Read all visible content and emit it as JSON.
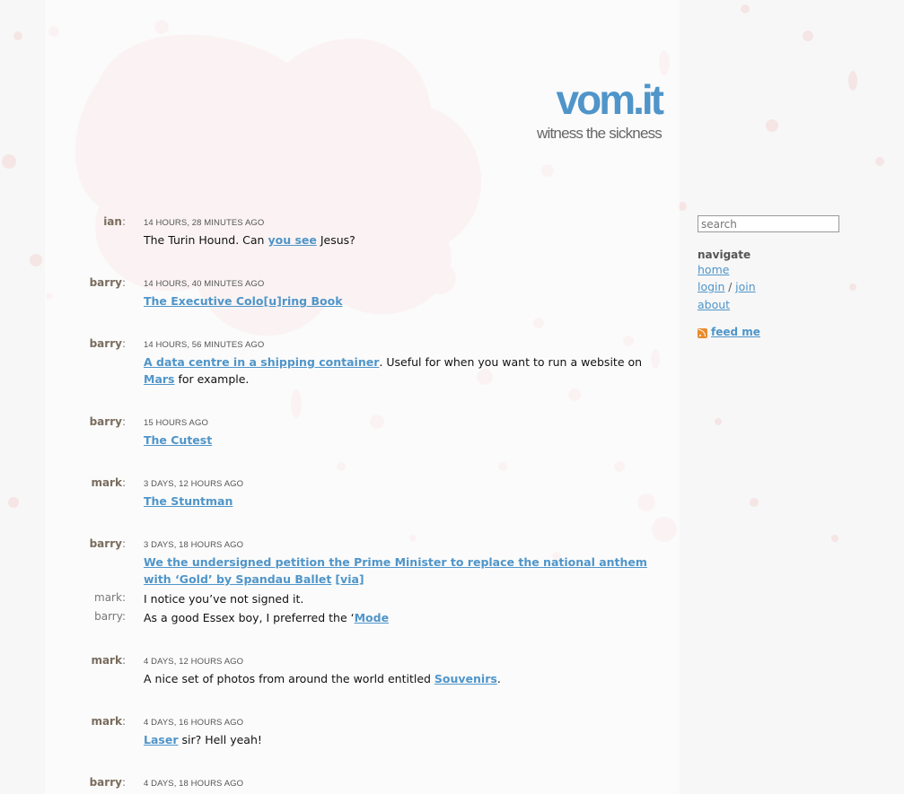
{
  "logo": {
    "brand": "vom.it",
    "tagline": "witness the sickness"
  },
  "entries": [
    {
      "user": "ian",
      "time": "14 hours, 28 minutes ago",
      "pre": "The Turin Hound. Can ",
      "link": "you see",
      "post": " Jesus?"
    },
    {
      "user": "barry",
      "time": "14 hours, 40 minutes ago",
      "pre": "",
      "link": "The Executive Colo[u]ring Book",
      "post": ""
    },
    {
      "user": "barry",
      "time": "14 hours, 56 minutes ago",
      "link": "A data centre in a shipping container",
      "mid": ". Useful for when you want to run a website on ",
      "link2": "Mars",
      "post": " for example."
    },
    {
      "user": "barry",
      "time": "15 hours ago",
      "pre": "",
      "link": "The Cutest",
      "post": ""
    },
    {
      "user": "mark",
      "time": "3 days, 12 hours ago",
      "pre": "",
      "link": "The Stuntman",
      "post": ""
    },
    {
      "user": "barry",
      "time": "3 days, 18 hours ago",
      "link": "We the undersigned petition the Prime Minister to replace the national anthem with ‘Gold’ by Spandau Ballet",
      "via": "[via]"
    },
    {
      "user": "mark",
      "time": "4 days, 12 hours ago",
      "pre": "A nice set of photos from around the world entitled ",
      "link": "Souvenirs",
      "post": "."
    },
    {
      "user": "mark",
      "time": "4 days, 16 hours ago",
      "pre": "",
      "link": "Laser",
      "post": " sir? Hell yeah!"
    },
    {
      "user": "barry",
      "time": "4 days, 18 hours ago"
    }
  ],
  "comments": [
    {
      "user": "mark",
      "text": "I notice you’ve not signed it."
    },
    {
      "user": "barry",
      "pre": "As a good Essex boy, I preferred the ‘",
      "link": "Mode"
    }
  ],
  "sidebar": {
    "search_placeholder": "search",
    "nav_title": "navigate",
    "home": "home",
    "login": "login",
    "sep": "/",
    "join": "join",
    "about": "about",
    "feed": "feed me"
  },
  "colors": {
    "accent": "#4f95c9",
    "splatter": "#f7e4e4",
    "username": "#7a6c5d"
  }
}
